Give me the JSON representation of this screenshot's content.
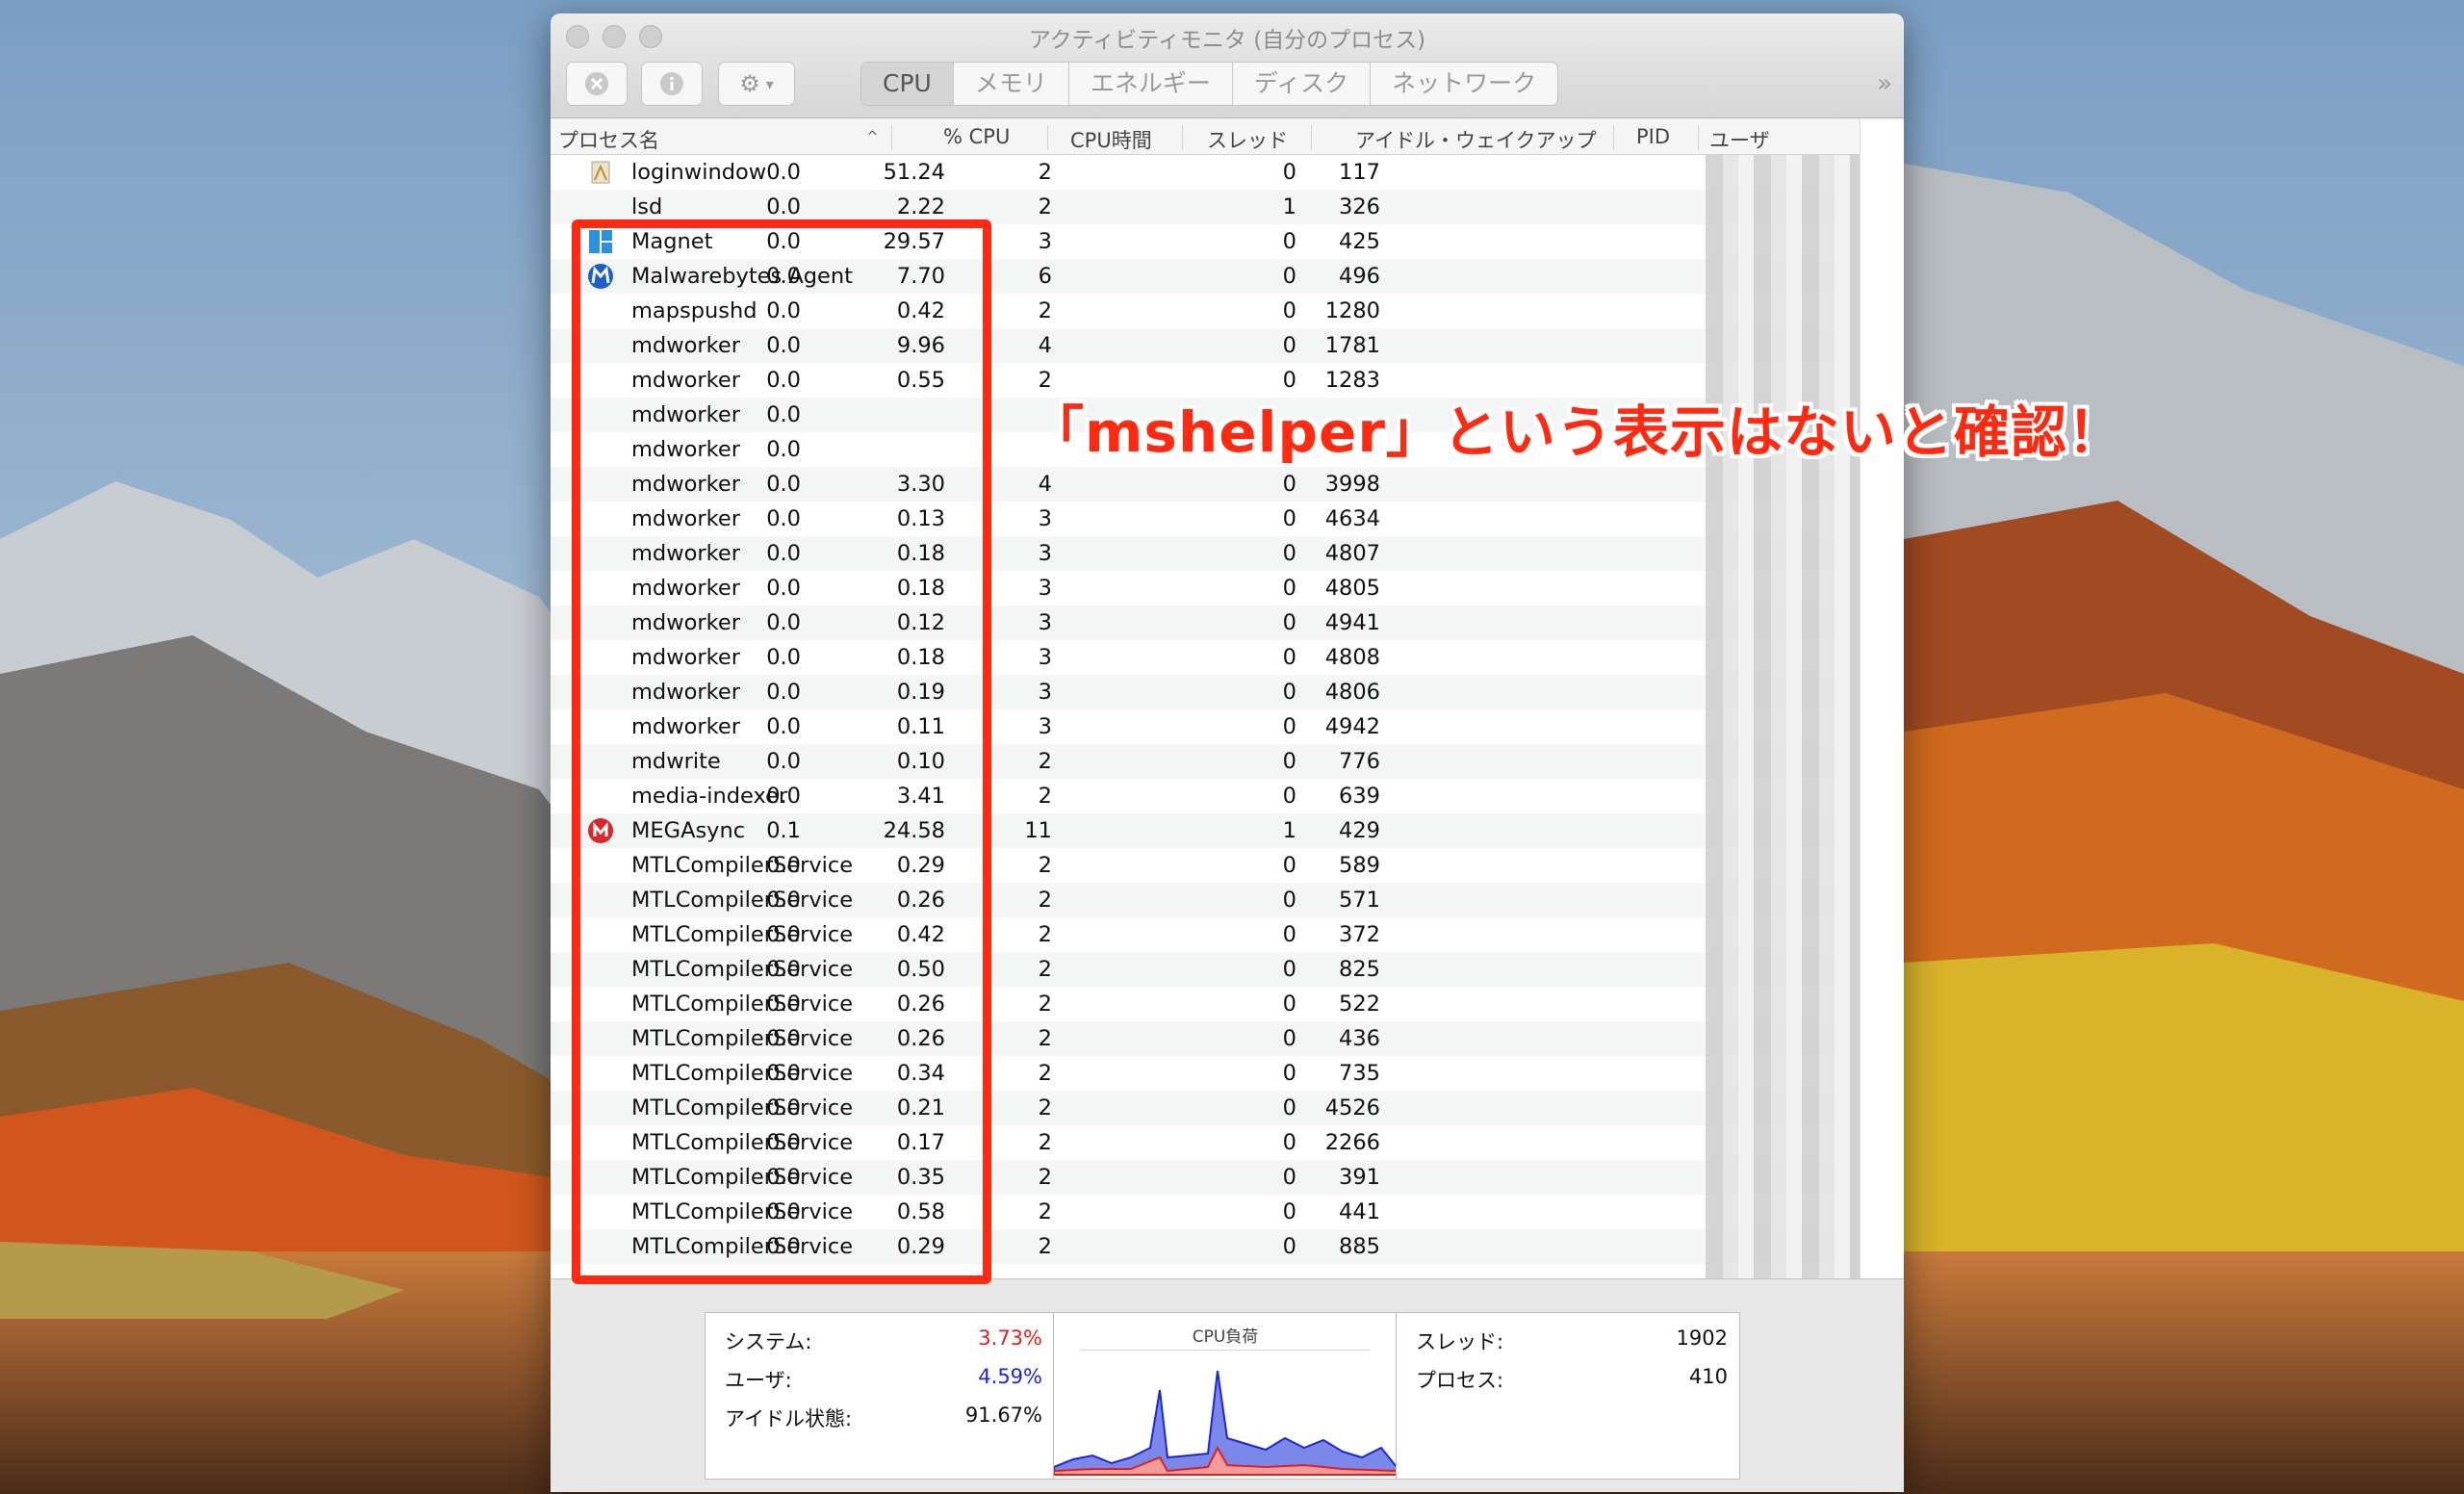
{
  "window": {
    "title": "アクティビティモニタ (自分のプロセス)",
    "tabs": [
      {
        "label": "CPU",
        "active": true
      },
      {
        "label": "メモリ",
        "active": false
      },
      {
        "label": "エネルギー",
        "active": false
      },
      {
        "label": "ディスク",
        "active": false
      },
      {
        "label": "ネットワーク",
        "active": false
      }
    ],
    "toolbar": {
      "stop_icon": "stop-process-icon",
      "info_icon": "info-icon",
      "gear_icon": "gear-icon",
      "more_glyph": "»"
    }
  },
  "columns": {
    "process_name": "プロセス名",
    "cpu_percent": "% CPU",
    "cpu_time": "CPU時間",
    "threads": "スレッド",
    "idle_wakeups": "アイドル・ウェイクアップ",
    "pid": "PID",
    "user": "ユーザ"
  },
  "rows": [
    {
      "icon": "loginwindow-icon",
      "name": "loginwindow",
      "cpu": "0.0",
      "time": "51.24",
      "threads": "2",
      "idle": "0",
      "pid": "117"
    },
    {
      "icon": "",
      "name": "lsd",
      "cpu": "0.0",
      "time": "2.22",
      "threads": "2",
      "idle": "1",
      "pid": "326"
    },
    {
      "icon": "magnet-icon",
      "name": "Magnet",
      "cpu": "0.0",
      "time": "29.57",
      "threads": "3",
      "idle": "0",
      "pid": "425"
    },
    {
      "icon": "malwarebytes-icon",
      "name": "Malwarebytes Agent",
      "cpu": "0.0",
      "time": "7.70",
      "threads": "6",
      "idle": "0",
      "pid": "496"
    },
    {
      "icon": "",
      "name": "mapspushd",
      "cpu": "0.0",
      "time": "0.42",
      "threads": "2",
      "idle": "0",
      "pid": "1280"
    },
    {
      "icon": "",
      "name": "mdworker",
      "cpu": "0.0",
      "time": "9.96",
      "threads": "4",
      "idle": "0",
      "pid": "1781"
    },
    {
      "icon": "",
      "name": "mdworker",
      "cpu": "0.0",
      "time": "0.55",
      "threads": "2",
      "idle": "0",
      "pid": "1283"
    },
    {
      "icon": "",
      "name": "mdworker",
      "cpu": "0.0",
      "time": "",
      "threads": "",
      "idle": "",
      "pid": ""
    },
    {
      "icon": "",
      "name": "mdworker",
      "cpu": "0.0",
      "time": "",
      "threads": "",
      "idle": "",
      "pid": ""
    },
    {
      "icon": "",
      "name": "mdworker",
      "cpu": "0.0",
      "time": "3.30",
      "threads": "4",
      "idle": "0",
      "pid": "3998"
    },
    {
      "icon": "",
      "name": "mdworker",
      "cpu": "0.0",
      "time": "0.13",
      "threads": "3",
      "idle": "0",
      "pid": "4634"
    },
    {
      "icon": "",
      "name": "mdworker",
      "cpu": "0.0",
      "time": "0.18",
      "threads": "3",
      "idle": "0",
      "pid": "4807"
    },
    {
      "icon": "",
      "name": "mdworker",
      "cpu": "0.0",
      "time": "0.18",
      "threads": "3",
      "idle": "0",
      "pid": "4805"
    },
    {
      "icon": "",
      "name": "mdworker",
      "cpu": "0.0",
      "time": "0.12",
      "threads": "3",
      "idle": "0",
      "pid": "4941"
    },
    {
      "icon": "",
      "name": "mdworker",
      "cpu": "0.0",
      "time": "0.18",
      "threads": "3",
      "idle": "0",
      "pid": "4808"
    },
    {
      "icon": "",
      "name": "mdworker",
      "cpu": "0.0",
      "time": "0.19",
      "threads": "3",
      "idle": "0",
      "pid": "4806"
    },
    {
      "icon": "",
      "name": "mdworker",
      "cpu": "0.0",
      "time": "0.11",
      "threads": "3",
      "idle": "0",
      "pid": "4942"
    },
    {
      "icon": "",
      "name": "mdwrite",
      "cpu": "0.0",
      "time": "0.10",
      "threads": "2",
      "idle": "0",
      "pid": "776"
    },
    {
      "icon": "",
      "name": "media-indexer",
      "cpu": "0.0",
      "time": "3.41",
      "threads": "2",
      "idle": "0",
      "pid": "639"
    },
    {
      "icon": "mega-icon",
      "name": "MEGAsync",
      "cpu": "0.1",
      "time": "24.58",
      "threads": "11",
      "idle": "1",
      "pid": "429"
    },
    {
      "icon": "",
      "name": "MTLCompilerService",
      "cpu": "0.0",
      "time": "0.29",
      "threads": "2",
      "idle": "0",
      "pid": "589"
    },
    {
      "icon": "",
      "name": "MTLCompilerService",
      "cpu": "0.0",
      "time": "0.26",
      "threads": "2",
      "idle": "0",
      "pid": "571"
    },
    {
      "icon": "",
      "name": "MTLCompilerService",
      "cpu": "0.0",
      "time": "0.42",
      "threads": "2",
      "idle": "0",
      "pid": "372"
    },
    {
      "icon": "",
      "name": "MTLCompilerService",
      "cpu": "0.0",
      "time": "0.50",
      "threads": "2",
      "idle": "0",
      "pid": "825"
    },
    {
      "icon": "",
      "name": "MTLCompilerService",
      "cpu": "0.0",
      "time": "0.26",
      "threads": "2",
      "idle": "0",
      "pid": "522"
    },
    {
      "icon": "",
      "name": "MTLCompilerService",
      "cpu": "0.0",
      "time": "0.26",
      "threads": "2",
      "idle": "0",
      "pid": "436"
    },
    {
      "icon": "",
      "name": "MTLCompilerService",
      "cpu": "0.0",
      "time": "0.34",
      "threads": "2",
      "idle": "0",
      "pid": "735"
    },
    {
      "icon": "",
      "name": "MTLCompilerService",
      "cpu": "0.0",
      "time": "0.21",
      "threads": "2",
      "idle": "0",
      "pid": "4526"
    },
    {
      "icon": "",
      "name": "MTLCompilerService",
      "cpu": "0.0",
      "time": "0.17",
      "threads": "2",
      "idle": "0",
      "pid": "2266"
    },
    {
      "icon": "",
      "name": "MTLCompilerService",
      "cpu": "0.0",
      "time": "0.35",
      "threads": "2",
      "idle": "0",
      "pid": "391"
    },
    {
      "icon": "",
      "name": "MTLCompilerService",
      "cpu": "0.0",
      "time": "0.58",
      "threads": "2",
      "idle": "0",
      "pid": "441"
    },
    {
      "icon": "",
      "name": "MTLCompilerService",
      "cpu": "0.0",
      "time": "0.29",
      "threads": "2",
      "idle": "0",
      "pid": "885"
    }
  ],
  "summary": {
    "system_label": "システム:",
    "system_value": "3.73%",
    "user_label": "ユーザ:",
    "user_value": "4.59%",
    "idle_label": "アイドル状態:",
    "idle_value": "91.67%",
    "graph_title": "CPU負荷",
    "threads_label": "スレッド:",
    "threads_value": "1902",
    "processes_label": "プロセス:",
    "processes_value": "410"
  },
  "annotation": "「mshelper」という表示はないと確認！",
  "colors": {
    "system": "#e0201c",
    "user": "#1b27d6",
    "highlight": "#ff2a12"
  }
}
